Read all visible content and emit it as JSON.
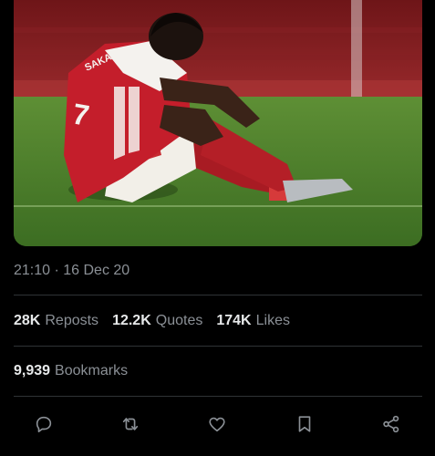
{
  "post": {
    "image": {
      "subject": "Arsenal player number 7 sitting on the pitch, head bowed",
      "shirt_name": "SAKA",
      "shirt_number": "7"
    },
    "timestamp": "21:10 · 16 Dec 20",
    "stats": {
      "reposts_count": "28K",
      "reposts_label": "Reposts",
      "quotes_count": "12.2K",
      "quotes_label": "Quotes",
      "likes_count": "174K",
      "likes_label": "Likes",
      "bookmarks_count": "9,939",
      "bookmarks_label": "Bookmarks"
    },
    "actions": [
      {
        "icon": "reply-icon"
      },
      {
        "icon": "repost-icon"
      },
      {
        "icon": "like-icon"
      },
      {
        "icon": "bookmark-icon"
      },
      {
        "icon": "share-icon"
      }
    ]
  },
  "colors": {
    "background": "#000000",
    "primary_text": "#e7e9ea",
    "secondary_text": "#8b9096",
    "divider": "#2f3336"
  }
}
